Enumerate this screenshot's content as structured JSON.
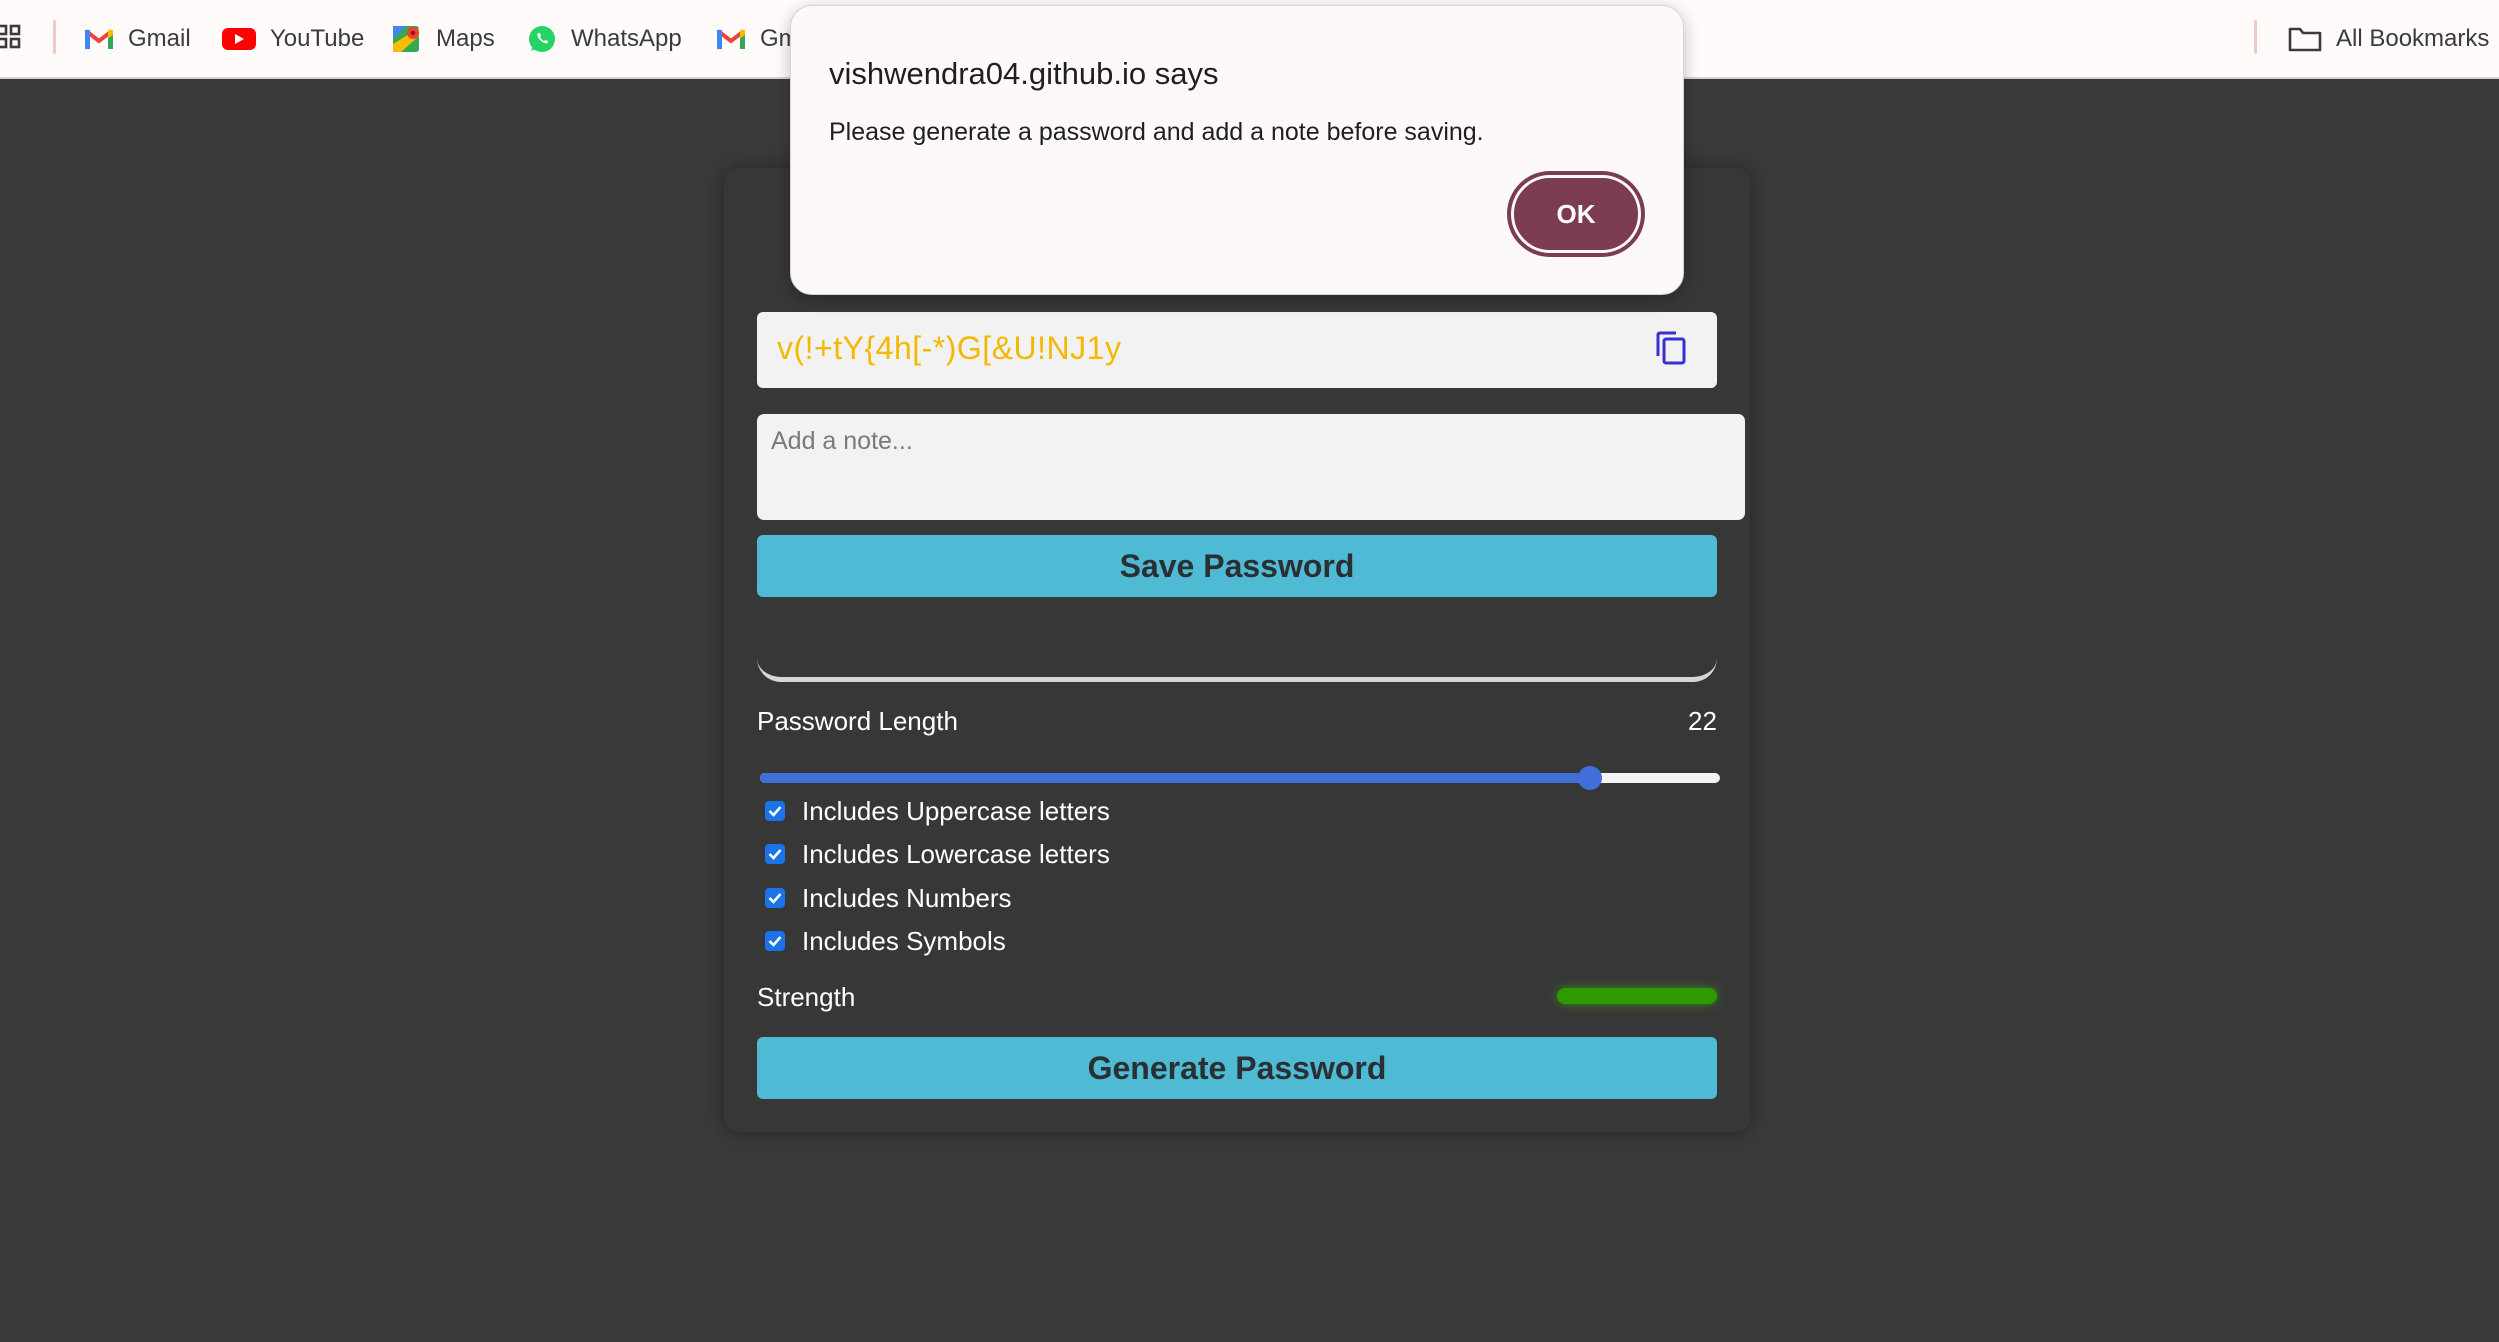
{
  "bookmarks": {
    "items": [
      {
        "label": "Gmail",
        "icon": "gmail-icon"
      },
      {
        "label": "YouTube",
        "icon": "youtube-icon"
      },
      {
        "label": "Maps",
        "icon": "maps-icon"
      },
      {
        "label": "WhatsApp",
        "icon": "whatsapp-icon"
      },
      {
        "label": "Gm",
        "icon": "gmail-icon"
      }
    ],
    "all_bookmarks": "All Bookmarks"
  },
  "generator": {
    "password": "v(!+tY{4h[-*)G[&U!NJ1y",
    "note_placeholder": "Add a note...",
    "save_label": "Save Password",
    "length_label": "Password Length",
    "length_value": "22",
    "length_slider_fraction": 0.865,
    "options": [
      {
        "label": "Includes Uppercase letters",
        "checked": true
      },
      {
        "label": "Includes Lowercase letters",
        "checked": true
      },
      {
        "label": "Includes Numbers",
        "checked": true
      },
      {
        "label": "Includes Symbols",
        "checked": true
      }
    ],
    "strength_label": "Strength",
    "strength_color": "#2d9a00",
    "generate_label": "Generate Password"
  },
  "dialog": {
    "title": "vishwendra04.github.io says",
    "message": "Please generate a password and add a note before saving.",
    "ok_label": "OK"
  },
  "colors": {
    "accent_button": "#4fbad4",
    "password_text": "#f5b800",
    "dialog_ok": "#7a3b53",
    "slider": "#3f6fd8"
  }
}
